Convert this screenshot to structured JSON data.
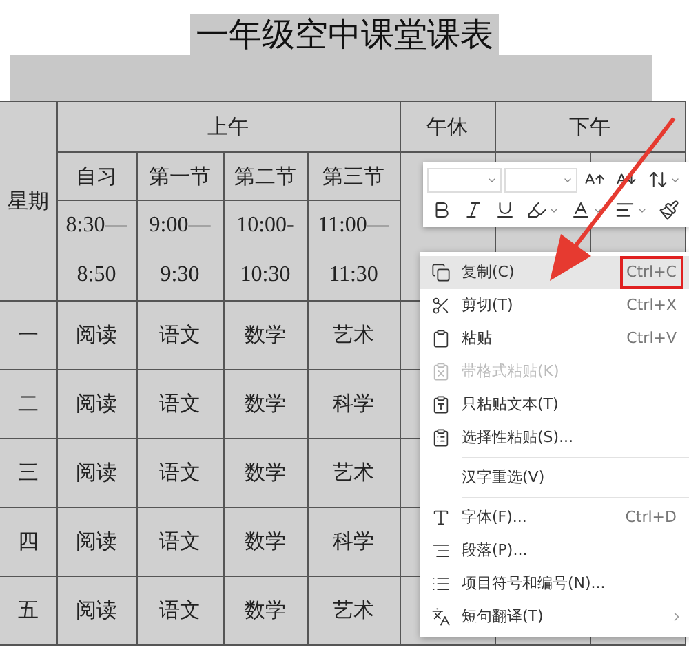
{
  "document": {
    "title": "一年级空中课堂课表"
  },
  "table": {
    "corner": "星期",
    "groups": [
      {
        "label": "上午"
      },
      {
        "label": "午休"
      },
      {
        "label": "下午"
      }
    ],
    "periods": [
      {
        "label": "自习",
        "time_start": "8:30—",
        "time_end": "8:50"
      },
      {
        "label": "第一节",
        "time_start": "9:00—",
        "time_end": "9:30"
      },
      {
        "label": "第二节",
        "time_start": "10:00-",
        "time_end": "10:30"
      },
      {
        "label": "第三节",
        "time_start": "11:00—",
        "time_end": "11:30"
      }
    ],
    "rows": [
      {
        "day": "一",
        "cells": [
          "阅读",
          "语文",
          "数学",
          "艺术"
        ]
      },
      {
        "day": "二",
        "cells": [
          "阅读",
          "语文",
          "数学",
          "科学"
        ]
      },
      {
        "day": "三",
        "cells": [
          "阅读",
          "语文",
          "数学",
          "艺术"
        ]
      },
      {
        "day": "四",
        "cells": [
          "阅读",
          "语文",
          "数学",
          "科学"
        ]
      },
      {
        "day": "五",
        "cells": [
          "阅读",
          "语文",
          "数学",
          "艺术"
        ]
      }
    ]
  },
  "context_menu": {
    "items": [
      {
        "kind": "item",
        "label": "复制(C)",
        "shortcut": "Ctrl+C",
        "shortcut_marked": true,
        "submenu": false,
        "highlighted": true,
        "disabled": false
      },
      {
        "kind": "item",
        "label": "剪切(T)",
        "shortcut": "Ctrl+X",
        "shortcut_marked": false,
        "submenu": false,
        "highlighted": false,
        "disabled": false
      },
      {
        "kind": "item",
        "label": "粘贴",
        "shortcut": "Ctrl+V",
        "shortcut_marked": false,
        "submenu": false,
        "highlighted": false,
        "disabled": false
      },
      {
        "kind": "item",
        "label": "带格式粘贴(K)",
        "submenu": false,
        "highlighted": false,
        "disabled": true
      },
      {
        "kind": "item",
        "label": "只粘贴文本(T)",
        "submenu": false,
        "highlighted": false,
        "disabled": false
      },
      {
        "kind": "item",
        "label": "选择性粘贴(S)...",
        "submenu": false,
        "highlighted": false,
        "disabled": false
      },
      {
        "kind": "separator"
      },
      {
        "kind": "item",
        "label": "汉字重选(V)",
        "submenu": false,
        "highlighted": false,
        "disabled": false
      },
      {
        "kind": "separator"
      },
      {
        "kind": "item",
        "label": "字体(F)...",
        "shortcut": "Ctrl+D",
        "shortcut_marked": false,
        "submenu": false,
        "highlighted": false,
        "disabled": false
      },
      {
        "kind": "item",
        "label": "段落(P)...",
        "submenu": false,
        "highlighted": false,
        "disabled": false
      },
      {
        "kind": "item",
        "label": "项目符号和编号(N)...",
        "submenu": false,
        "highlighted": false,
        "disabled": false
      },
      {
        "kind": "item",
        "label": "短句翻译(T)",
        "submenu": true,
        "highlighted": false,
        "disabled": false
      }
    ]
  }
}
